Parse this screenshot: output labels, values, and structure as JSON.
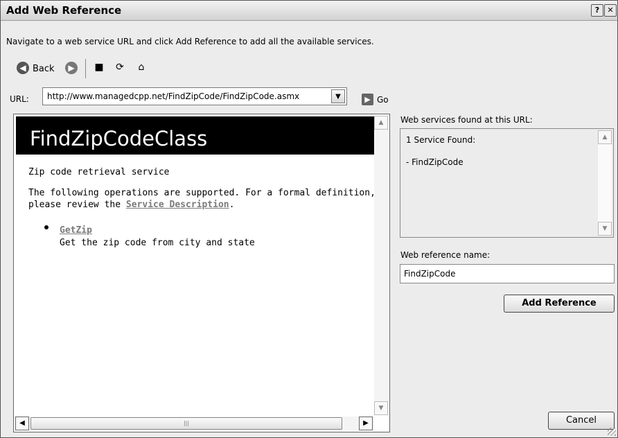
{
  "window": {
    "title": "Add Web Reference",
    "help_glyph": "?",
    "close_glyph": "✕"
  },
  "instruction": "Navigate to a web service URL and click Add Reference to add all the available services.",
  "toolbar": {
    "back_label": "Back",
    "icons": [
      "back-icon",
      "forward-icon",
      "stop-icon",
      "refresh-icon",
      "home-icon"
    ]
  },
  "url_bar": {
    "label": "URL:",
    "value": "http://www.managedcpp.net/FindZipCode/FindZipCode.asmx",
    "go_label": "Go"
  },
  "browser": {
    "page_title": "FindZipCodeClass",
    "description": "Zip code retrieval service",
    "operations_text_1": "The following operations are supported. For a formal definition,",
    "operations_text_2_prefix": "please review the ",
    "service_description_link": "Service Description",
    "operations_text_2_suffix": ".",
    "operations": [
      {
        "name": "GetZip",
        "description": "Get the zip code from city and state"
      }
    ]
  },
  "services_panel": {
    "label": "Web services found at this URL:",
    "count_text": "1 Service Found:",
    "items": [
      "- FindZipCode"
    ]
  },
  "reference": {
    "label": "Web reference name:",
    "value": "FindZipCode",
    "add_button": "Add Reference",
    "cancel_button": "Cancel"
  }
}
